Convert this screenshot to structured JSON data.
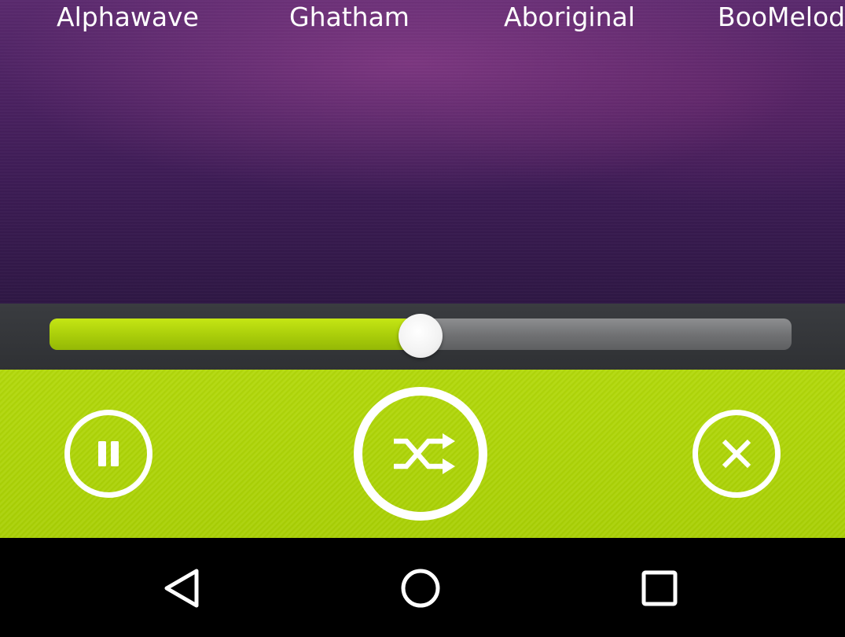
{
  "tabs": [
    {
      "label": "Alphawave"
    },
    {
      "label": "Ghatham"
    },
    {
      "label": "Aboriginal"
    },
    {
      "label": "BooMelod"
    }
  ],
  "player": {
    "progress": 0.5,
    "controls": {
      "pause_icon": "pause-icon",
      "shuffle_icon": "shuffle-icon",
      "close_icon": "close-icon"
    }
  },
  "navigation": {
    "back_icon": "back-triangle-icon",
    "home_icon": "home-circle-icon",
    "recents_icon": "recents-square-icon"
  },
  "colors": {
    "accent": "#a9d005",
    "background_purple": "#4c2262",
    "seek_fill": "#b2d80b",
    "seek_track": "#7a7b7d",
    "navbar": "#000000"
  }
}
